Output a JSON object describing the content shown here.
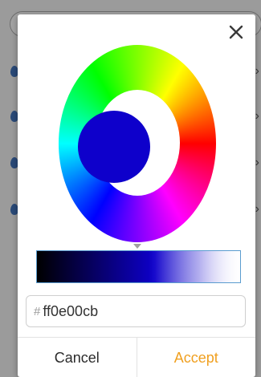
{
  "background": {
    "rows": 4
  },
  "dialog": {
    "close_icon": "close-icon",
    "picker": {
      "selected_color": "#0e00cb",
      "value_bar_colors": [
        "#000000",
        "#0e00cb",
        "#ffffff"
      ]
    },
    "hex_input": {
      "prefix": "#",
      "value": "ff0e00cb"
    },
    "buttons": {
      "cancel": "Cancel",
      "accept": "Accept"
    },
    "accent_color": "#f0a020"
  }
}
